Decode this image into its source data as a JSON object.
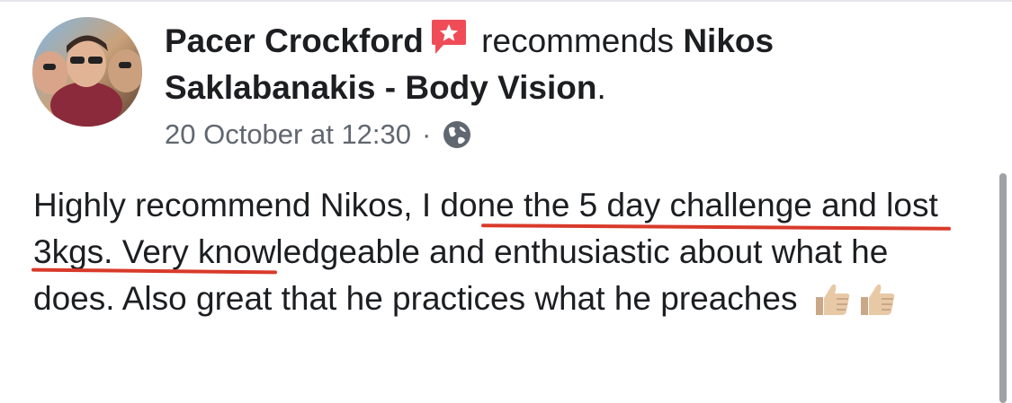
{
  "post": {
    "author": "Pacer Crockford",
    "action_text": " recommends ",
    "page_line1": "Nikos",
    "page_line2": "Saklabanakis - Body Vision",
    "page_end": ".",
    "timestamp": "20 October at 12:30",
    "separator": "·",
    "body_part1": "Highly recommend Nikos, ",
    "body_part2": "I done the 5 day challenge and lost 3kgs.",
    "body_part3": " Very knowledgeable and enthusiastic about what he does. Also great that he practices what he preaches ",
    "reactions_emoji": [
      "thumbs-up-icon",
      "thumbs-up-icon"
    ]
  },
  "colors": {
    "recommend_badge": "#f04c58",
    "annotation_underline": "#d93a2b",
    "meta_text": "#606770",
    "text": "#1c1e21"
  },
  "icons": {
    "recommend": "recommend-icon",
    "privacy": "globe-icon"
  }
}
